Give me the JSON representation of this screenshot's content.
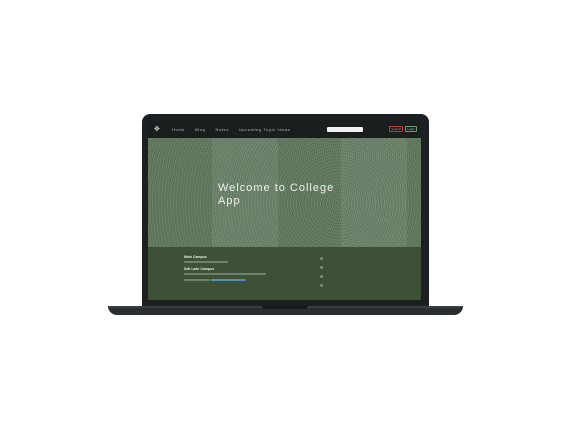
{
  "nav": {
    "logo_glyph": "✥",
    "links": [
      "Home",
      "Blog",
      "Notes",
      "Upcoming Topic Ideas"
    ],
    "search_placeholder": "",
    "search_button": "Search",
    "login_button": "Login"
  },
  "hero": {
    "title": "Welcome to College App"
  },
  "footer": {
    "campus_1": "Main Campus",
    "campus_2": "Salt Lake Campus"
  },
  "colors": {
    "navbar": "#1b1e1f",
    "hero": "#5f7a5c",
    "footer": "#3e5035",
    "laptop": "#1d2023"
  }
}
